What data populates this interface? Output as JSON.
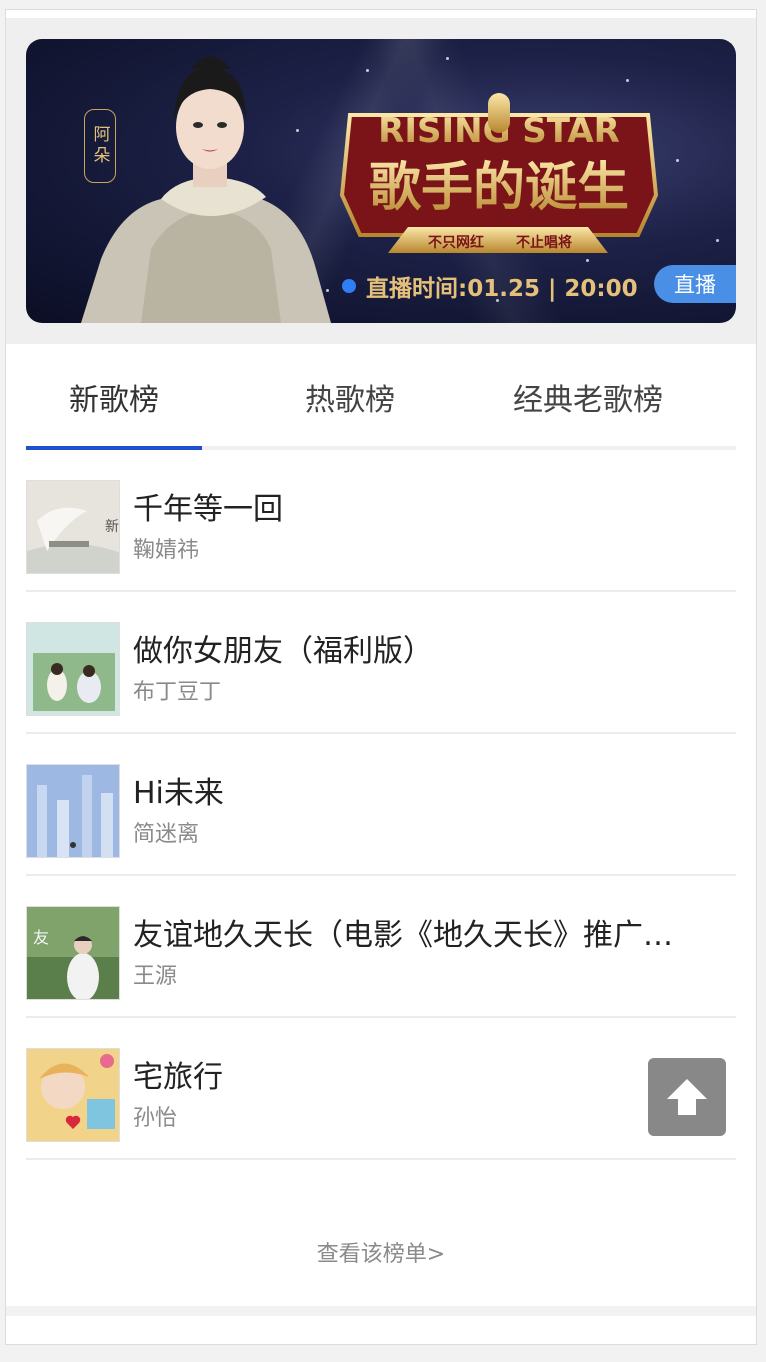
{
  "banner": {
    "badge_text": "阿朵",
    "show_title_en": "RISING STAR",
    "show_title_cn": "歌手的诞生",
    "slogan_left": "不只网红",
    "slogan_right": "不止唱将",
    "air_time": "直播时间:01.25 | 20:00",
    "live_label": "直播",
    "colors": {
      "gold": "#e5c07b",
      "live_blue": "#4a8fe6"
    }
  },
  "tabs": [
    {
      "label": "新歌榜",
      "active": true
    },
    {
      "label": "热歌榜",
      "active": false
    },
    {
      "label": "经典老歌榜",
      "active": false
    }
  ],
  "songs": [
    {
      "title": "千年等一回",
      "artist": "鞠婧祎",
      "cover": "misty-lake-cover"
    },
    {
      "title": "做你女朋友（福利版）",
      "artist": "布丁豆丁",
      "cover": "couple-garden-cover"
    },
    {
      "title": "Hi未来",
      "artist": "简迷离",
      "cover": "blue-pillars-cover"
    },
    {
      "title": "友谊地久天长（电影《地久天长》推广…",
      "artist": "王源",
      "cover": "boy-trees-cover"
    },
    {
      "title": "宅旅行",
      "artist": "孙怡",
      "cover": "girl-doodle-cover"
    }
  ],
  "more_link": "查看该榜单>",
  "back_to_top_icon": "arrow-up-icon"
}
